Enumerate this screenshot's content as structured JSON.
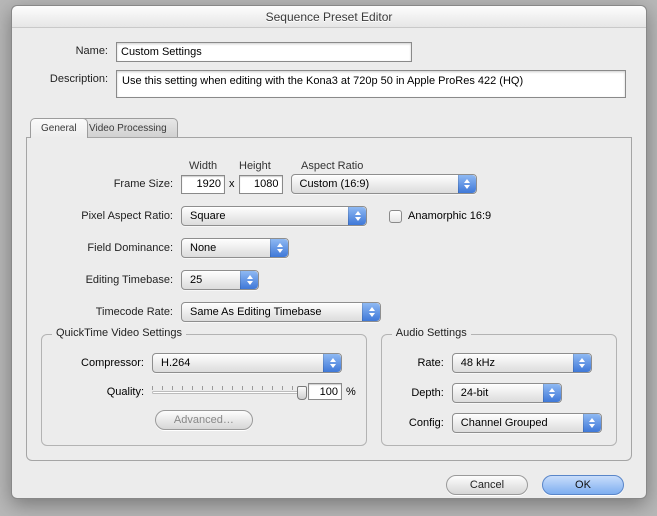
{
  "window": {
    "title": "Sequence Preset Editor"
  },
  "top": {
    "name_label": "Name:",
    "name_value": "Custom Settings",
    "desc_label": "Description:",
    "desc_value": "Use this setting when editing with the Kona3 at 720p 50 in Apple ProRes 422 (HQ)"
  },
  "tabs": {
    "general": "General",
    "video_processing": "Video Processing"
  },
  "general": {
    "head_width": "Width",
    "head_height": "Height",
    "head_aspect": "Aspect Ratio",
    "frame_size_label": "Frame Size:",
    "width": "1920",
    "height": "1080",
    "aspect_value": "Custom (16:9)",
    "par_label": "Pixel Aspect Ratio:",
    "par_value": "Square",
    "anamorphic_label": "Anamorphic 16:9",
    "field_label": "Field Dominance:",
    "field_value": "None",
    "timebase_label": "Editing Timebase:",
    "timebase_value": "25",
    "tcrate_label": "Timecode Rate:",
    "tcrate_value": "Same As Editing Timebase"
  },
  "qt": {
    "legend": "QuickTime Video Settings",
    "compressor_label": "Compressor:",
    "compressor_value": "H.264",
    "quality_label": "Quality:",
    "quality_value": "100",
    "pct": "%",
    "advanced": "Advanced…"
  },
  "audio": {
    "legend": "Audio Settings",
    "rate_label": "Rate:",
    "rate_value": "48 kHz",
    "depth_label": "Depth:",
    "depth_value": "24-bit",
    "config_label": "Config:",
    "config_value": "Channel Grouped"
  },
  "footer": {
    "cancel": "Cancel",
    "ok": "OK"
  }
}
